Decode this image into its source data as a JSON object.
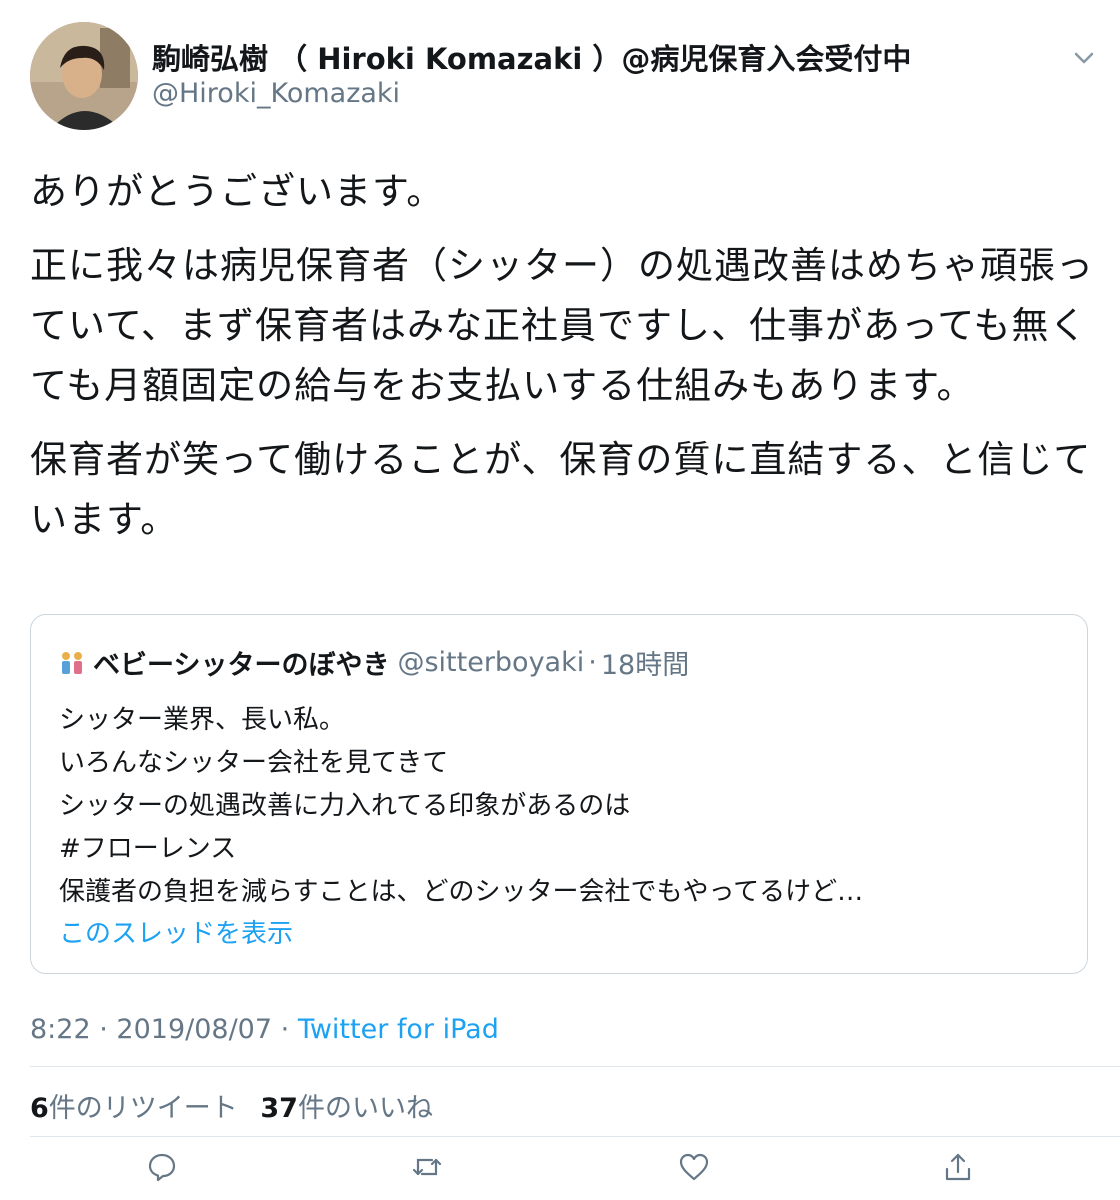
{
  "author": {
    "display_name": "駒崎弘樹 （ Hiroki Komazaki ）@病児保育入会受付中",
    "handle": "@Hiroki_Komazaki",
    "avatar": "avatar"
  },
  "menu_icon": "chevron-down-icon",
  "tweet": {
    "paragraphs": [
      "ありがとうございます。",
      "正に我々は病児保育者（シッター）の処遇改善はめちゃ頑張っていて、まず保育者はみな正社員ですし、仕事があっても無くても月額固定の給与をお支払いする仕組みもあります。",
      "保育者が笑って働けることが、保育の質に直結する、と信じています。"
    ]
  },
  "quoted": {
    "name": "ベビーシッターのぼやき",
    "handle": "@sitterboyaki",
    "separator": "·",
    "time": "18時間",
    "body": "シッター業界、長い私。\nいろんなシッター会社を見てきて\nシッターの処遇改善に力入れてる印象があるのは\n#フローレンス\n保護者の負担を減らすことは、どのシッター会社でもやってるけど…",
    "thread_link": "このスレッドを表示",
    "emoji": "two-people-emoji"
  },
  "meta": {
    "time": "8:22",
    "sep1": "·",
    "date": "2019/08/07",
    "sep2": "·",
    "source": "Twitter for iPad"
  },
  "stats": {
    "retweets_count": "6",
    "retweets_label": "件のリツイート",
    "likes_count": "37",
    "likes_label": "件のいいね"
  },
  "actions": [
    "reply-icon",
    "retweet-icon",
    "like-icon",
    "share-icon"
  ],
  "colors": {
    "text": "#14171a",
    "secondary": "#657786",
    "link": "#1da1f2",
    "border": "#ccd6dd"
  }
}
